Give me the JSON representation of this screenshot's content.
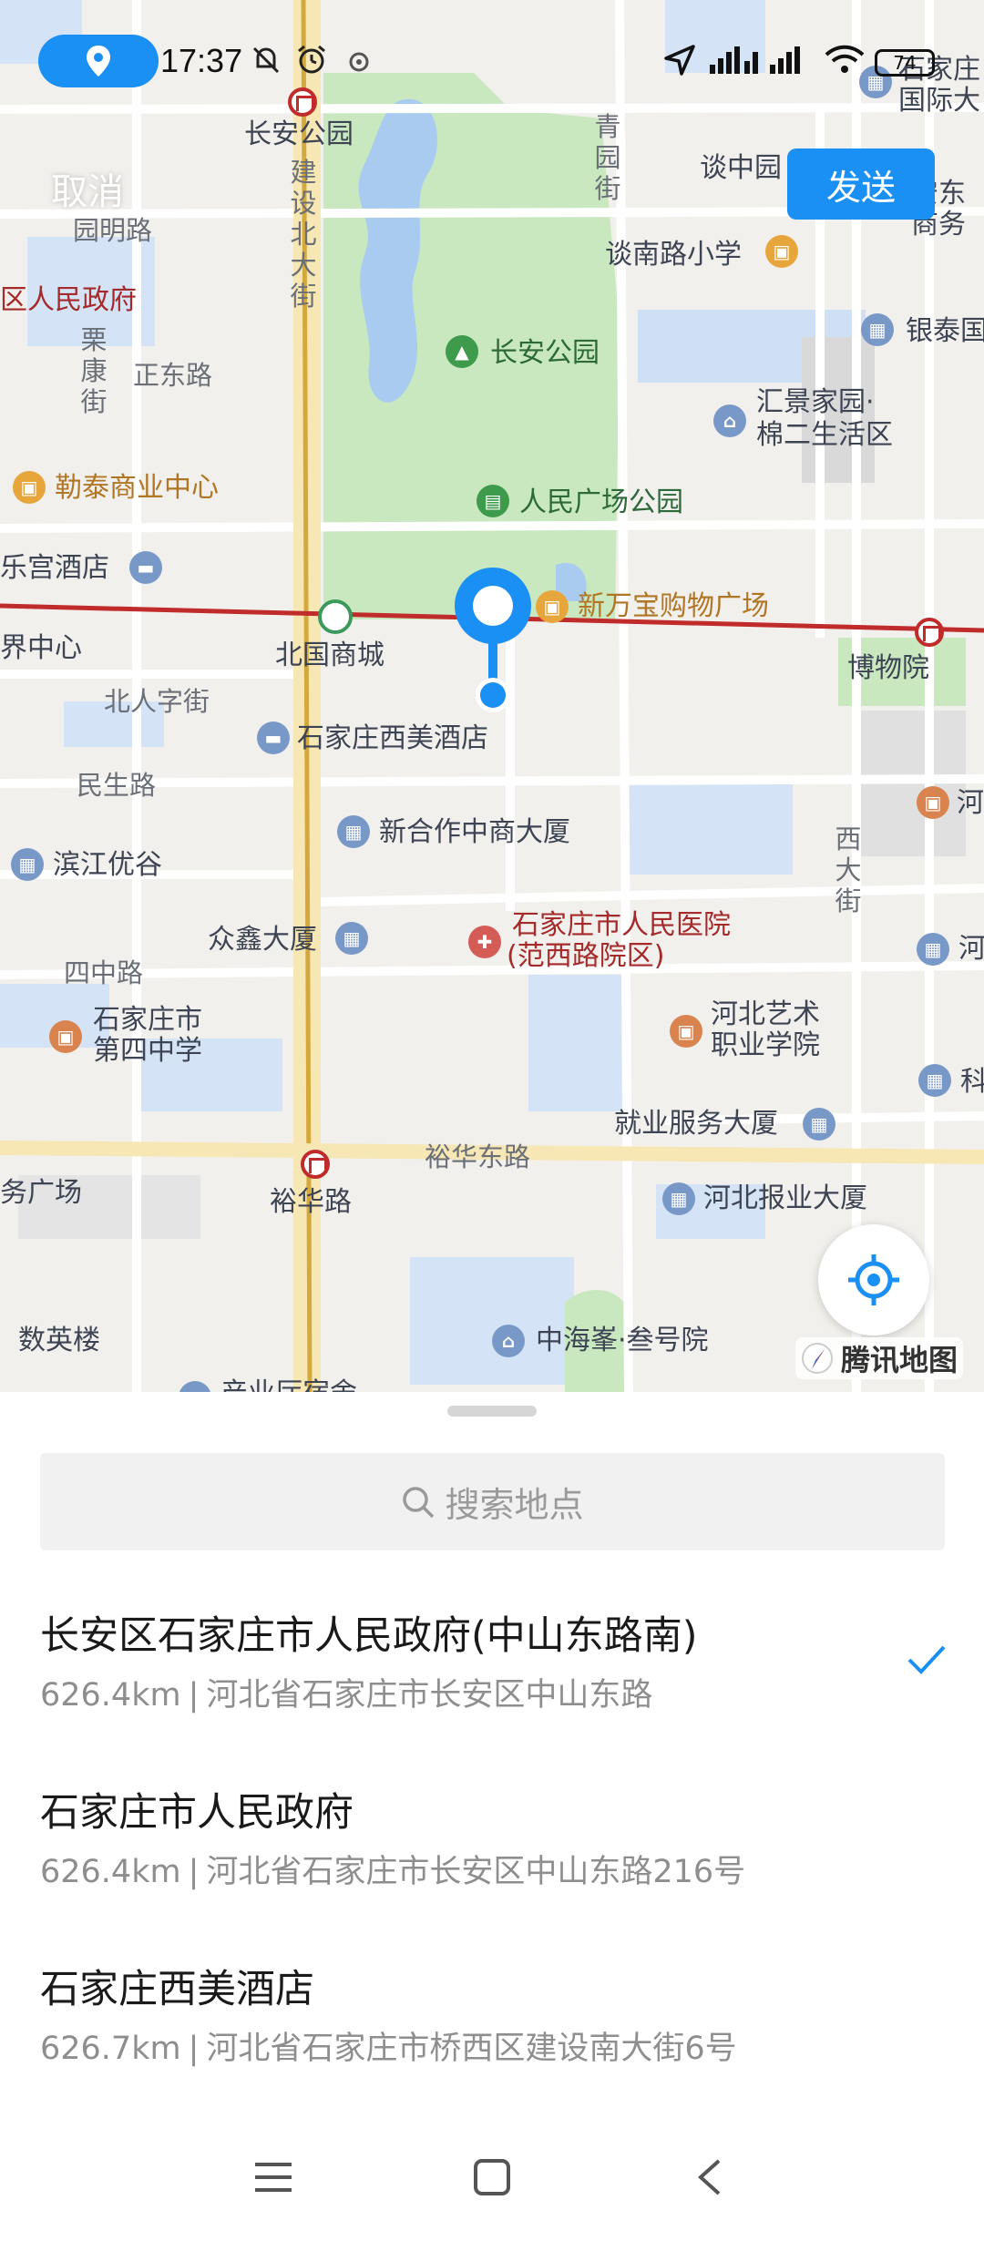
{
  "status_bar": {
    "time": "17:37",
    "battery": "74",
    "icons": [
      "location-pin-icon",
      "dnd-icon",
      "alarm-icon",
      "app-notification-icon",
      "navigation-arrow-icon",
      "signal-icon",
      "wifi-icon",
      "battery-icon"
    ]
  },
  "header": {
    "cancel_label": "取消",
    "send_label": "发送"
  },
  "map": {
    "brand": "腾讯地图",
    "labels": {
      "changan_park_station": "长安公园",
      "qingyuan_st": "青园街",
      "tannanlu_primary": "谈南路小学",
      "tanzhong": "谈中园",
      "shijiazhuang_intl": "石家庄国际大",
      "anjia_business": "安东商务",
      "yuanming_rd": "园明路",
      "jianshe_north": "建设北大街",
      "district_gov": "区人民政府",
      "zhengdong_rd": "正东路",
      "lidong_st": "栗康街",
      "changan_park": "长安公园",
      "yintai": "银泰国",
      "huijing_1": "汇景家园·",
      "huijing_2": "棉二生活区",
      "letai": "勒泰商业中心",
      "renmin_plaza": "人民广场公园",
      "legong_hotel": "乐宫酒店",
      "xinwanbao": "新万宝购物广场",
      "world_center": "界中心",
      "beiguo": "北国商城",
      "museum": "博物院",
      "beirenzi": "北人字街",
      "ximei_hotel": "石家庄西美酒店",
      "minsheng_rd": "民生路",
      "xinhezuo": "新合作中商大厦",
      "binjiang": "滨江优谷",
      "xida_st": "西大街",
      "he_right_1": "河",
      "zhongxin": "众鑫大厦",
      "hospital_1": "石家庄市人民医院",
      "hospital_2": "(范西路院区)",
      "he_right_2": "河",
      "sizhong_rd": "四中路",
      "no4_school_1": "石家庄市",
      "no4_school_2": "第四中学",
      "art_college_1": "河北艺术",
      "art_college_2": "职业学院",
      "employment": "就业服务大厦",
      "ke_right": "科",
      "yuhua_east": "裕华东路",
      "yuhua_rd": "裕华路",
      "wu_plaza": "务广场",
      "hebei_news": "河北报业大厦",
      "shuying": "数英楼",
      "zhonghai": "中海峯·叁号院",
      "bottom_cut": "产业厅宿舍"
    }
  },
  "sheet": {
    "search_placeholder": "搜索地点",
    "results": [
      {
        "title": "长安区石家庄市人民政府(中山东路南)",
        "distance": "626.4km",
        "address": "河北省石家庄市长安区中山东路",
        "selected": true
      },
      {
        "title": "石家庄市人民政府",
        "distance": "626.4km",
        "address": "河北省石家庄市长安区中山东路216号",
        "selected": false
      },
      {
        "title": "石家庄西美酒店",
        "distance": "626.7km",
        "address": "河北省石家庄市桥西区建设南大街6号",
        "selected": false
      }
    ],
    "separator": "|"
  },
  "colors": {
    "accent": "#1a8ff4",
    "metro_red": "#c02b2b",
    "park_green": "#c9e8c0",
    "water_blue": "#a9cbf0"
  }
}
